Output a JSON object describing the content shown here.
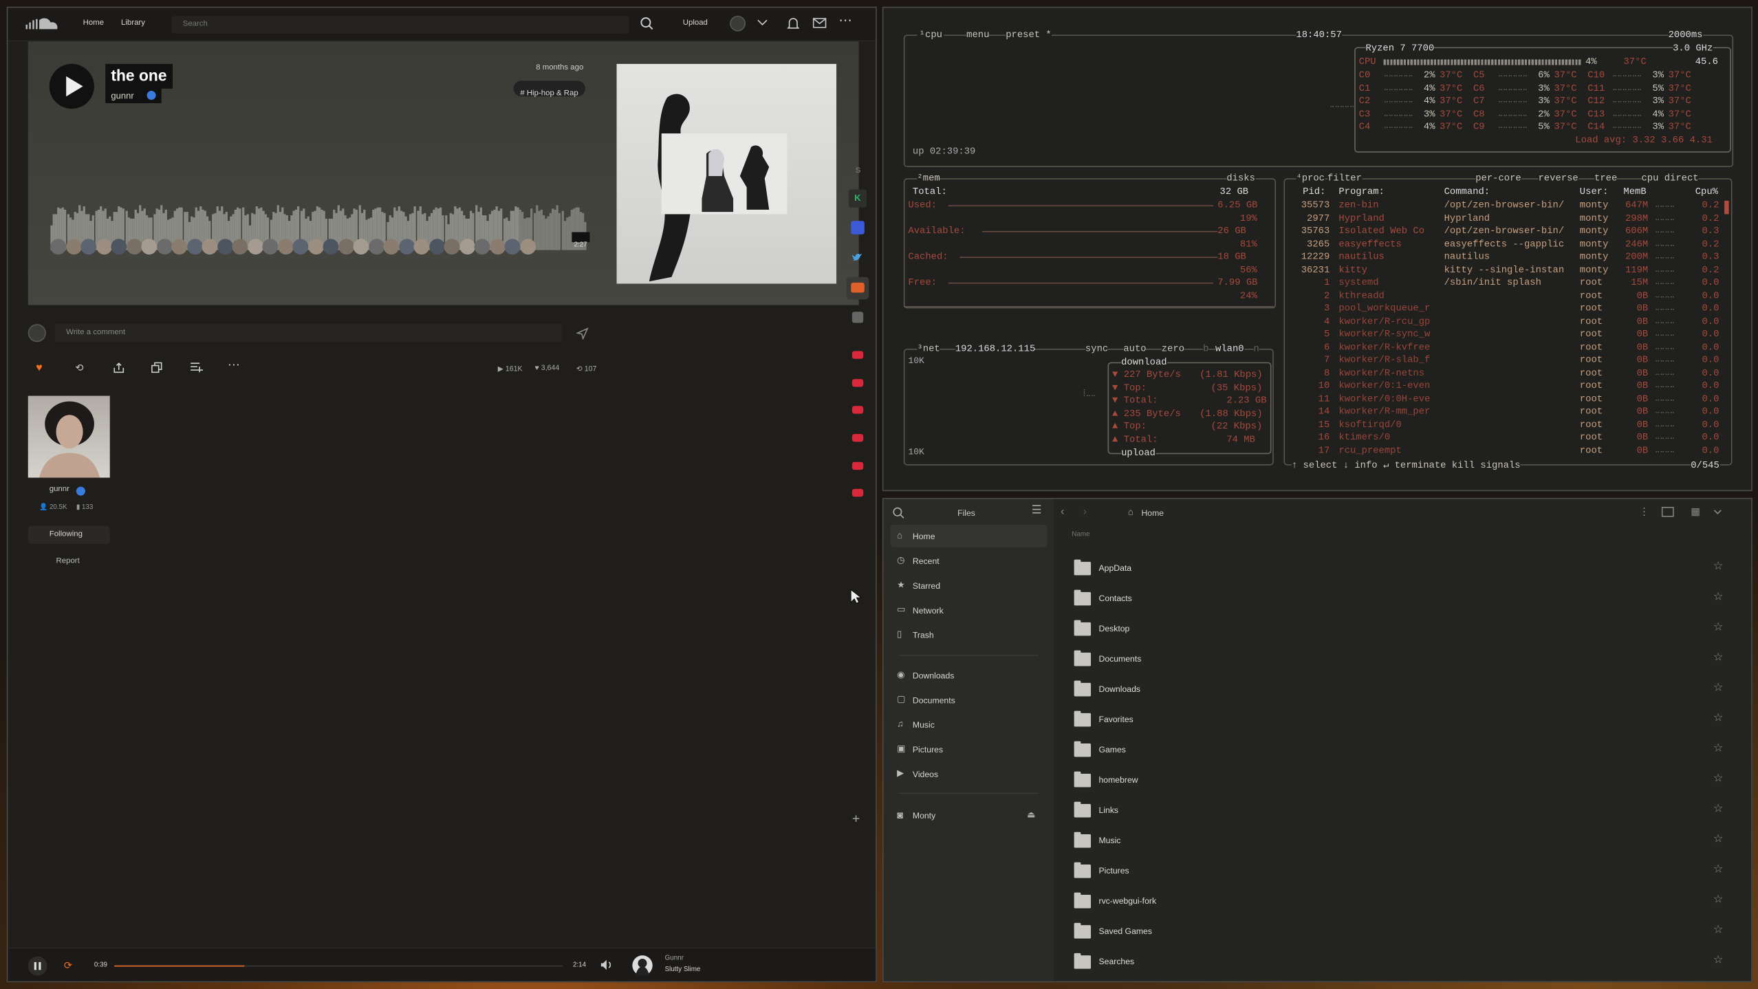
{
  "soundcloud": {
    "nav": {
      "home": "Home",
      "library": "Library",
      "search_placeholder": "Search",
      "upload": "Upload"
    },
    "track": {
      "title": "the one",
      "artist": "gunnr",
      "age": "8 months ago",
      "tag": "# Hip-hop & Rap",
      "duration": "2:27"
    },
    "comment_placeholder": "Write a comment",
    "stats": {
      "plays": "161K",
      "likes": "3,644",
      "reposts": "107"
    },
    "artist_card": {
      "name": "gunnr",
      "followers": "20.5K",
      "tracks": "133",
      "following_label": "Following",
      "report_label": "Report"
    },
    "player": {
      "elapsed": "0:39",
      "total": "2:14",
      "progress": 0.29,
      "artist": "Gunnr",
      "title": "Slutty Slime"
    },
    "sidebar_letters": {
      "s": "S",
      "k": "K"
    }
  },
  "btop": {
    "header": {
      "cpu": "cpu",
      "menu": "menu",
      "preset": "preset *",
      "time": "18:40:57",
      "interval": "2000ms"
    },
    "cpu_box": {
      "model": "Ryzen 7 7700",
      "freq": "3.0 GHz",
      "total_label": "CPU",
      "total_pct": "4%",
      "total_temp": "37°C",
      "pkg_temp": "45.6",
      "cores": [
        [
          "C0",
          "2%",
          "37°C"
        ],
        [
          "C1",
          "4%",
          "37°C"
        ],
        [
          "C2",
          "4%",
          "37°C"
        ],
        [
          "C3",
          "3%",
          "37°C"
        ],
        [
          "C4",
          "4%",
          "37°C"
        ],
        [
          "C5",
          "6%",
          "37°C"
        ],
        [
          "C6",
          "3%",
          "37°C"
        ],
        [
          "C7",
          "3%",
          "37°C"
        ],
        [
          "C8",
          "2%",
          "37°C"
        ],
        [
          "C9",
          "5%",
          "37°C"
        ],
        [
          "C10",
          "3%",
          "37°C"
        ],
        [
          "C11",
          "5%",
          "37°C"
        ],
        [
          "C12",
          "3%",
          "37°C"
        ],
        [
          "C13",
          "4%",
          "37°C"
        ],
        [
          "C14",
          "3%",
          "37°C"
        ]
      ],
      "load": "Load avg: 3.32 3.66 4.31"
    },
    "uptime": "up 02:39:39",
    "mem": {
      "title": "mem",
      "disks": "disks",
      "total_label": "Total:",
      "total": "32 GB",
      "used_label": "Used:",
      "used": "6.25 GB",
      "used_pct": "19%",
      "avail_label": "Available:",
      "avail": "26 GB",
      "avail_pct": "81%",
      "cached_label": "Cached:",
      "cached": "18 GB",
      "cached_pct": "56%",
      "free_label": "Free:",
      "free": "7.99 GB",
      "free_pct": "24%"
    },
    "net": {
      "title": "net",
      "ip": "192.168.12.115",
      "sync": "sync",
      "auto": "auto",
      "zero": "zero",
      "b": "b",
      "iface": "wlan0",
      "n": "n",
      "scale_top": "10K",
      "scale_bot": "10K",
      "download": "download",
      "upload": "upload",
      "dl_rate": "227 Byte/s",
      "dl_kbps": "(1.81 Kbps)",
      "dl_top_label": "Top:",
      "dl_top": "(35 Kbps)",
      "dl_total_label": "Total:",
      "dl_total": "2.23 GB",
      "ul_rate": "235 Byte/s",
      "ul_kbps": "(1.88 Kbps)",
      "ul_top_label": "Top:",
      "ul_top": "(22 Kbps)",
      "ul_total_label": "Total:",
      "ul_total": "74 MB"
    },
    "proc": {
      "title": "proc",
      "filter": "filter",
      "per_core": "per-core",
      "reverse": "reverse",
      "tree": "tree",
      "sort": "cpu direct",
      "cols": {
        "pid": "Pid:",
        "program": "Program:",
        "command": "Command:",
        "user": "User:",
        "mem": "MemB",
        "cpu": "Cpu%"
      },
      "rows": [
        [
          "35573",
          "zen-bin",
          "/opt/zen-browser-bin/",
          "monty",
          "647M",
          "0.2"
        ],
        [
          "2977",
          "Hyprland",
          "Hyprland",
          "monty",
          "298M",
          "0.2"
        ],
        [
          "35763",
          "Isolated Web Co",
          "/opt/zen-browser-bin/",
          "monty",
          "606M",
          "0.3"
        ],
        [
          "3265",
          "easyeffects",
          "easyeffects --gapplic",
          "monty",
          "246M",
          "0.2"
        ],
        [
          "12229",
          "nautilus",
          "nautilus",
          "monty",
          "200M",
          "0.3"
        ],
        [
          "36231",
          "kitty",
          "kitty --single-instan",
          "monty",
          "119M",
          "0.2"
        ],
        [
          "1",
          "systemd",
          "/sbin/init splash",
          "root",
          "15M",
          "0.0"
        ],
        [
          "2",
          "kthreadd",
          "",
          "root",
          "0B",
          "0.0"
        ],
        [
          "3",
          "pool_workqueue_r",
          "",
          "root",
          "0B",
          "0.0"
        ],
        [
          "4",
          "kworker/R-rcu_gp",
          "",
          "root",
          "0B",
          "0.0"
        ],
        [
          "5",
          "kworker/R-sync_w",
          "",
          "root",
          "0B",
          "0.0"
        ],
        [
          "6",
          "kworker/R-kvfree",
          "",
          "root",
          "0B",
          "0.0"
        ],
        [
          "7",
          "kworker/R-slab_f",
          "",
          "root",
          "0B",
          "0.0"
        ],
        [
          "8",
          "kworker/R-netns",
          "",
          "root",
          "0B",
          "0.0"
        ],
        [
          "10",
          "kworker/0:1-even",
          "",
          "root",
          "0B",
          "0.0"
        ],
        [
          "11",
          "kworker/0:0H-eve",
          "",
          "root",
          "0B",
          "0.0"
        ],
        [
          "14",
          "kworker/R-mm_per",
          "",
          "root",
          "0B",
          "0.0"
        ],
        [
          "15",
          "ksoftirqd/0",
          "",
          "root",
          "0B",
          "0.0"
        ],
        [
          "16",
          "ktimers/0",
          "",
          "root",
          "0B",
          "0.0"
        ],
        [
          "17",
          "rcu_preempt",
          "",
          "root",
          "0B",
          "0.0"
        ]
      ],
      "footer": {
        "select": "select",
        "info": "info",
        "terminate": "terminate",
        "kill": "kill",
        "signals": "signals",
        "count": "0/545"
      }
    }
  },
  "files": {
    "title": "Files",
    "path": "Home",
    "col_name": "Name",
    "sidebar": [
      {
        "label": "Home",
        "icon": "home-icon"
      },
      {
        "label": "Recent",
        "icon": "clock-icon"
      },
      {
        "label": "Starred",
        "icon": "star-icon"
      },
      {
        "label": "Network",
        "icon": "network-icon"
      },
      {
        "label": "Trash",
        "icon": "trash-icon"
      }
    ],
    "places": [
      {
        "label": "Downloads",
        "icon": "download-icon"
      },
      {
        "label": "Documents",
        "icon": "document-icon"
      },
      {
        "label": "Music",
        "icon": "music-icon"
      },
      {
        "label": "Pictures",
        "icon": "picture-icon"
      },
      {
        "label": "Videos",
        "icon": "video-icon"
      }
    ],
    "drive": "Monty",
    "folders": [
      "AppData",
      "Contacts",
      "Desktop",
      "Documents",
      "Downloads",
      "Favorites",
      "Games",
      "homebrew",
      "Links",
      "Music",
      "Pictures",
      "rvc-webgui-fork",
      "Saved Games",
      "Searches"
    ]
  }
}
